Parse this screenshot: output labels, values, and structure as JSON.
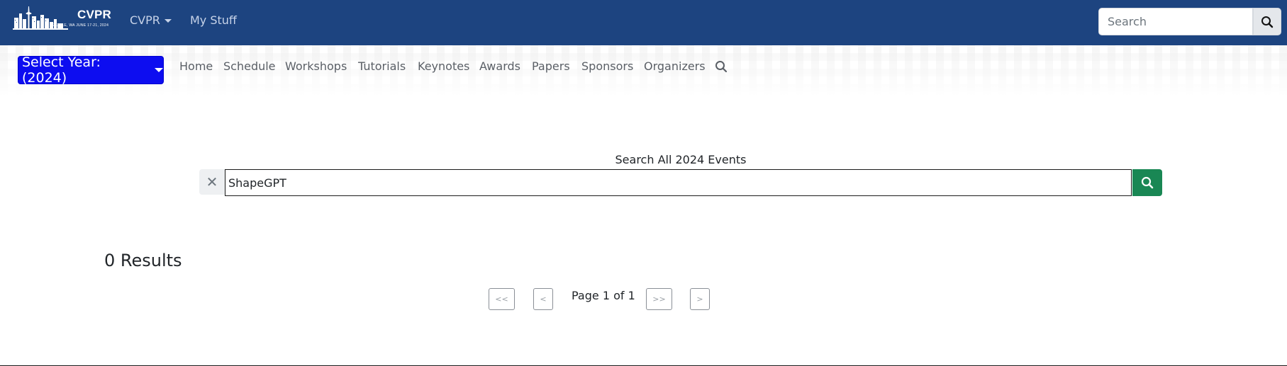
{
  "topbar": {
    "logo_text": "CVPR",
    "logo_subtext": "SEATTLE, WA  JUNE 17-21, 2024",
    "nav_cvpr": "CVPR",
    "nav_mystuff": "My Stuff",
    "search_placeholder": "Search"
  },
  "subnav": {
    "year_button": "Select Year: (2024)",
    "links": [
      "Home",
      "Schedule",
      "Workshops",
      "Tutorials",
      "Keynotes",
      "Awards",
      "Papers",
      "Sponsors",
      "Organizers"
    ]
  },
  "search": {
    "heading": "Search All 2024 Events",
    "clear_symbol": "✕",
    "value": "ShapeGPT"
  },
  "results": {
    "count_label": "0 Results",
    "first_label": "<<",
    "prev_label": "<",
    "page_label": "Page 1 of 1",
    "last_label": ">>",
    "next_label": ">"
  },
  "colors": {
    "topbar": "#1d4480",
    "year_button": "#0d0df0",
    "search_button": "#198754"
  }
}
